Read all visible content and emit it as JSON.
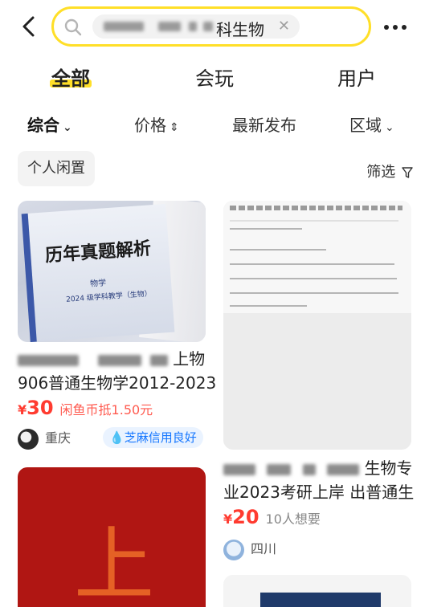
{
  "search": {
    "query_visible": "科生物",
    "clear_icon": "close-icon"
  },
  "tabs": [
    {
      "label": "全部",
      "active": true
    },
    {
      "label": "会玩",
      "active": false
    },
    {
      "label": "用户",
      "active": false
    }
  ],
  "sort": [
    {
      "label": "综合",
      "icon": "chevron-down-icon",
      "active": true
    },
    {
      "label": "价格",
      "icon": "sort-updown-icon",
      "active": false
    },
    {
      "label": "最新发布",
      "icon": "",
      "active": false
    },
    {
      "label": "区域",
      "icon": "chevron-down-icon",
      "active": false
    }
  ],
  "filter": {
    "pill": "个人闲置",
    "button": "筛选"
  },
  "items": [
    {
      "image_title": "历年真题解析",
      "image_sub": "物学",
      "image_sub2": "2024 级学科教学（生物）",
      "title_line1_tail": "上物",
      "title_line2": "906普通生物学2012-2023",
      "price_currency": "¥",
      "price": "30",
      "price_extra": "闲鱼币抵1.50元",
      "location": "重庆",
      "badge": "芝麻信用良好"
    },
    {
      "title_line1_tail": "生物专",
      "title_line2": "业2023考研上岸 出普通生",
      "price_currency": "¥",
      "price": "20",
      "want": "10人想要",
      "location": "四川"
    },
    {
      "image_char": "上"
    }
  ],
  "colors": {
    "accent": "#ffdf28",
    "price": "#ff3b30",
    "badge": "#1677ff"
  }
}
